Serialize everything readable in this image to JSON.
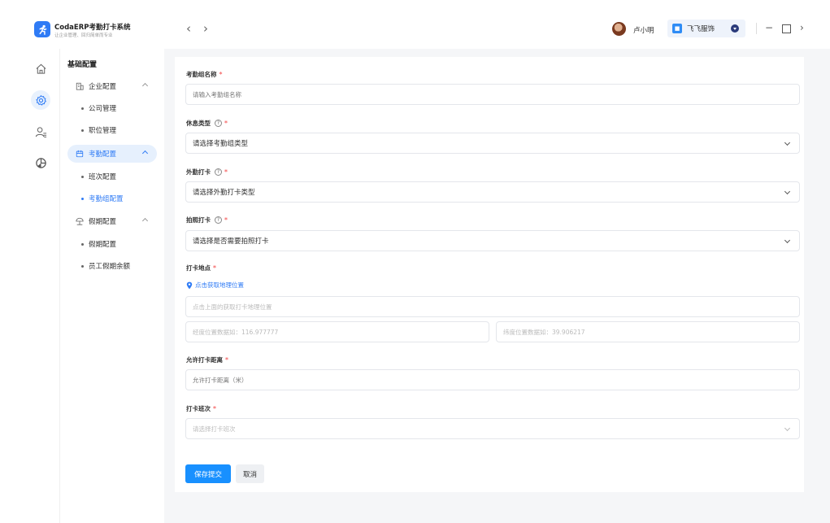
{
  "app": {
    "title": "CodaERP考勤打卡系统",
    "subtitle": "让企业管理、回归简单而专业",
    "logo_icon": "running-figure-icon",
    "accent_color": "#2f7bf5"
  },
  "header": {
    "back_glyph": "‹",
    "forward_glyph": "›",
    "user_name": "卢小明",
    "company_name": "飞飞服饰",
    "company_icon_glyph": "■",
    "window_min": "−",
    "window_more": "›"
  },
  "rail": {
    "items": [
      {
        "icon": "home-icon"
      },
      {
        "icon": "gear-icon",
        "active": true
      },
      {
        "icon": "user-list-icon"
      },
      {
        "icon": "pie-chart-icon"
      }
    ]
  },
  "sidebar": {
    "heading": "基础配置",
    "groups": [
      {
        "label": "企业配置",
        "icon": "building-icon",
        "items": [
          "公司管理",
          "职位管理"
        ]
      },
      {
        "label": "考勤配置",
        "icon": "calendar-icon",
        "active": true,
        "items": [
          "班次配置",
          "考勤组配置"
        ],
        "active_item": "考勤组配置"
      },
      {
        "label": "假期配置",
        "icon": "umbrella-icon",
        "items": [
          "假期配置",
          "员工假期余额"
        ]
      }
    ]
  },
  "form": {
    "name": {
      "label": "考勤组名称",
      "placeholder": "请输入考勤组名称"
    },
    "rest_type": {
      "label": "休息类型",
      "value": "请选择考勤组类型"
    },
    "field_punch": {
      "label": "外勤打卡",
      "value": "请选择外勤打卡类型"
    },
    "photo_punch": {
      "label": "拍照打卡",
      "value": "请选择是否需要拍照打卡"
    },
    "location": {
      "label": "打卡地点",
      "link": "点击获取地理位置",
      "address_placeholder": "点击上面的获取打卡地理位置",
      "longitude": "经度位置数据如：116.977777",
      "latitude": "纬度位置数据如：39.906217"
    },
    "distance": {
      "label": "允许打卡距离",
      "placeholder": "允许打卡距离（米）"
    },
    "shift": {
      "label": "打卡班次",
      "placeholder": "请选择打卡班次"
    },
    "required_mark": "*",
    "help_glyph": "?",
    "submit": "保存提交",
    "cancel": "取消"
  }
}
